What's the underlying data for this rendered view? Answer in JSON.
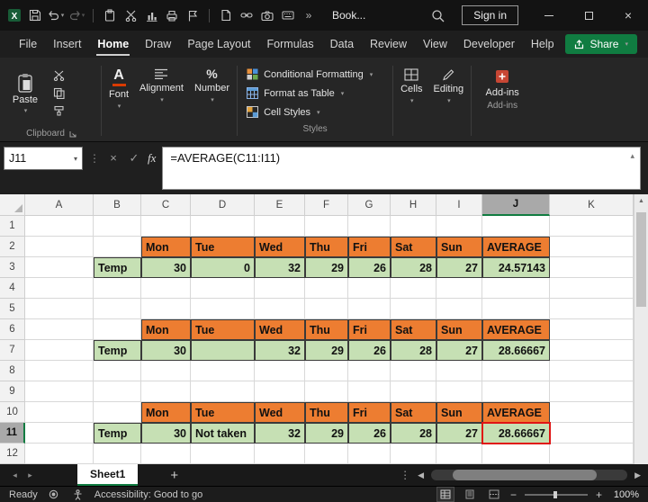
{
  "title_bar": {
    "workbook_title": "Book...",
    "sign_in_label": "Sign in",
    "icons": [
      "excel-app",
      "save",
      "undo",
      "redo",
      "clipboard",
      "cut",
      "chart",
      "printer",
      "flag",
      "document",
      "link",
      "camera",
      "touch-keyboard",
      "overflow",
      "search",
      "minimize",
      "maximize",
      "close"
    ]
  },
  "menu": {
    "tabs": [
      "File",
      "Insert",
      "Home",
      "Draw",
      "Page Layout",
      "Formulas",
      "Data",
      "Review",
      "View",
      "Developer",
      "Help"
    ],
    "active_tab": "Home",
    "share_label": "Share"
  },
  "ribbon": {
    "paste": "Paste",
    "clipboard_group": "Clipboard",
    "font_group": "Font",
    "alignment_group": "Alignment",
    "number_group": "Number",
    "styles_buttons": [
      "Conditional Formatting",
      "Format as Table",
      "Cell Styles"
    ],
    "styles_group": "Styles",
    "cells_group": "Cells",
    "editing_group": "Editing",
    "addins_button": "Add-ins",
    "addins_group": "Add-ins"
  },
  "formula_bar": {
    "name_box": "J11",
    "fx": "fx",
    "formula": "=AVERAGE(C11:I11)"
  },
  "grid": {
    "columns": [
      "A",
      "B",
      "C",
      "D",
      "E",
      "F",
      "G",
      "H",
      "I",
      "J",
      "K"
    ],
    "row_count": 12,
    "selected_column": "J",
    "selected_row": 11,
    "row_label": "Temp",
    "day_headers": [
      "Mon",
      "Tue",
      "Wed",
      "Thu",
      "Fri",
      "Sat",
      "Sun"
    ],
    "average_header": "AVERAGE",
    "tables": [
      {
        "header_row": 2,
        "data_row": 3,
        "values": [
          "30",
          "0",
          "32",
          "29",
          "26",
          "28",
          "27"
        ],
        "average": "24.57143",
        "highlight": false
      },
      {
        "header_row": 6,
        "data_row": 7,
        "values": [
          "30",
          "",
          "32",
          "29",
          "26",
          "28",
          "27"
        ],
        "average": "28.66667",
        "highlight": false
      },
      {
        "header_row": 10,
        "data_row": 11,
        "values": [
          "30",
          "Not taken",
          "32",
          "29",
          "26",
          "28",
          "27"
        ],
        "average": "28.66667",
        "highlight": true
      }
    ],
    "colors": {
      "header_fill": "#ED7D31",
      "data_fill": "#C6E0B4",
      "selection_red": "#E01414",
      "accent_green": "#107C41"
    }
  },
  "sheet_bar": {
    "active_tab": "Sheet1"
  },
  "status_bar": {
    "mode": "Ready",
    "accessibility": "Accessibility: Good to go",
    "zoom": "100%"
  }
}
